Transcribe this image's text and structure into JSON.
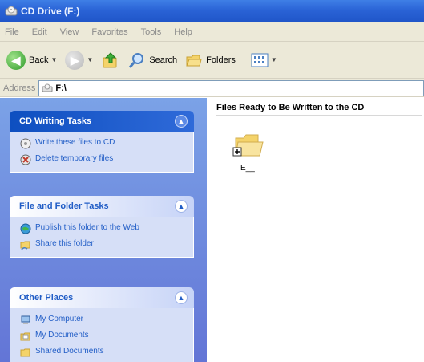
{
  "window": {
    "title": "CD Drive (F:)"
  },
  "menu": [
    "File",
    "Edit",
    "View",
    "Favorites",
    "Tools",
    "Help"
  ],
  "toolbar": {
    "back_label": "Back",
    "search_label": "Search",
    "folders_label": "Folders"
  },
  "address": {
    "label": "Address",
    "value": "F:\\"
  },
  "panels": {
    "cd_tasks": {
      "title": "CD Writing Tasks",
      "items": [
        "Write these files to CD",
        "Delete temporary files"
      ]
    },
    "file_tasks": {
      "title": "File and Folder Tasks",
      "items": [
        "Publish this folder to the Web",
        "Share this folder"
      ]
    },
    "other_places": {
      "title": "Other Places",
      "items": [
        "My Computer",
        "My Documents",
        "Shared Documents"
      ]
    }
  },
  "content": {
    "group_title": "Files Ready to Be Written to the CD",
    "files": [
      {
        "name": "E__",
        "icon": "folder-icon"
      }
    ]
  },
  "colors": {
    "title_bar": "#2a63d6",
    "task_pane": "#7ba2e7",
    "panel_body": "#d6dff7",
    "link": "#215dc6"
  }
}
